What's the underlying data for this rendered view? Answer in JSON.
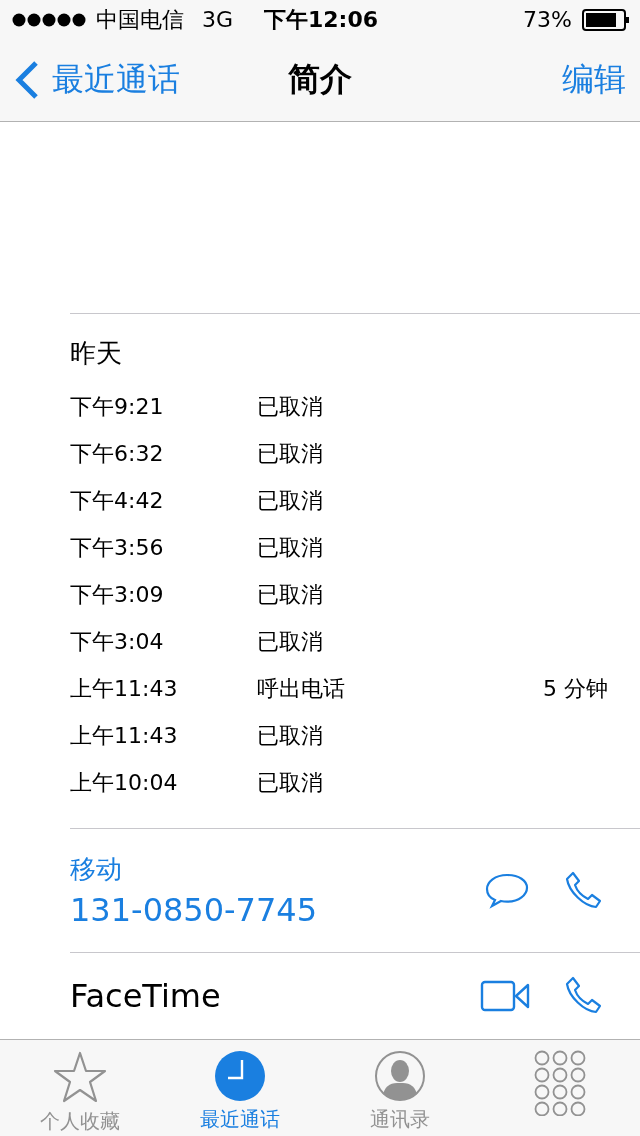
{
  "status_bar": {
    "carrier": "中国电信",
    "network": "3G",
    "time": "下午12:06",
    "battery": "73%"
  },
  "nav": {
    "back": "最近通话",
    "title": "简介",
    "action": "编辑"
  },
  "calls": {
    "date": "昨天",
    "rows": [
      {
        "time": "下午9:21",
        "type": "已取消"
      },
      {
        "time": "下午6:32",
        "type": "已取消"
      },
      {
        "time": "下午4:42",
        "type": "已取消"
      },
      {
        "time": "下午3:56",
        "type": "已取消"
      },
      {
        "time": "下午3:09",
        "type": "已取消"
      },
      {
        "time": "下午3:04",
        "type": "已取消"
      },
      {
        "time": "上午11:43",
        "type": "呼出电话",
        "duration": "5 分钟"
      },
      {
        "time": "上午11:43",
        "type": "已取消"
      },
      {
        "time": "上午10:04",
        "type": "已取消"
      }
    ]
  },
  "phone": {
    "label": "移动",
    "number": "131-0850-7745"
  },
  "facetime": {
    "label": "FaceTime"
  },
  "tabs": [
    {
      "kind": "favorites",
      "label": "个人收藏",
      "selected": false
    },
    {
      "kind": "recents",
      "label": "最近通话",
      "selected": true
    },
    {
      "kind": "contacts",
      "label": "通讯录",
      "selected": false
    },
    {
      "kind": "keypad",
      "selected": false
    }
  ]
}
